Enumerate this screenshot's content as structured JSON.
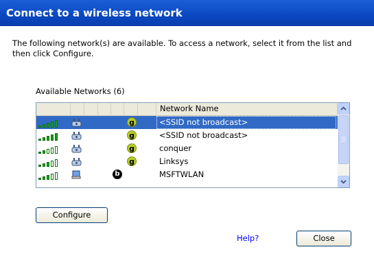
{
  "window": {
    "title": "Connect to a wireless network"
  },
  "description": "The following network(s) are available. To access a network, select it from the list and then click Configure.",
  "available_label": "Available Networks (6)",
  "list": {
    "column_header": "Network Name",
    "rows": [
      {
        "signal_bars": 5,
        "icon": "network-icon",
        "badge": "g",
        "name": "<SSID not broadcast>",
        "selected": true
      },
      {
        "signal_bars": 5,
        "icon": "network-icon",
        "badge": "g",
        "name": "<SSID not broadcast>",
        "selected": false
      },
      {
        "signal_bars": 2,
        "icon": "network-icon",
        "badge": "g",
        "name": "conquer",
        "selected": false
      },
      {
        "signal_bars": 3,
        "icon": "network-icon",
        "badge": "g",
        "name": "Linksys",
        "selected": false
      },
      {
        "signal_bars": 3,
        "icon": "adhoc-computer-icon",
        "badge": "b",
        "name": "MSFTWLAN",
        "selected": false
      }
    ]
  },
  "buttons": {
    "configure": "Configure",
    "close": "Close"
  },
  "help_link": "Help?",
  "colors": {
    "title_bar": "#0a47bf",
    "selection": "#316ac5",
    "signal_green": "#18a018",
    "g_badge": "#b7cf27"
  }
}
